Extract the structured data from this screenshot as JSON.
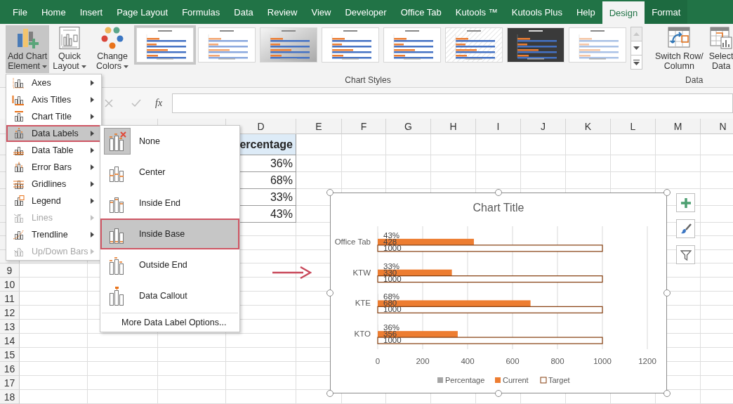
{
  "tabs": [
    {
      "label": "File",
      "selected": false,
      "kind": "main"
    },
    {
      "label": "Home",
      "selected": false,
      "kind": "main"
    },
    {
      "label": "Insert",
      "selected": false,
      "kind": "main"
    },
    {
      "label": "Page Layout",
      "selected": false,
      "kind": "main"
    },
    {
      "label": "Formulas",
      "selected": false,
      "kind": "main"
    },
    {
      "label": "Data",
      "selected": false,
      "kind": "main"
    },
    {
      "label": "Review",
      "selected": false,
      "kind": "main"
    },
    {
      "label": "View",
      "selected": false,
      "kind": "main"
    },
    {
      "label": "Developer",
      "selected": false,
      "kind": "main"
    },
    {
      "label": "Office Tab",
      "selected": false,
      "kind": "main"
    },
    {
      "label": "Kutools ™",
      "selected": false,
      "kind": "main"
    },
    {
      "label": "Kutools Plus",
      "selected": false,
      "kind": "main"
    },
    {
      "label": "Help",
      "selected": false,
      "kind": "main"
    },
    {
      "label": "Design",
      "selected": true,
      "kind": "contextual"
    },
    {
      "label": "Format",
      "selected": false,
      "kind": "contextual"
    }
  ],
  "ribbon": {
    "layout_buttons": [
      {
        "kind": "add-chart",
        "lines": [
          "Add Chart",
          "Element"
        ],
        "dropdown": true,
        "pressed": true
      },
      {
        "kind": "quick-layout",
        "lines": [
          "Quick",
          "Layout"
        ],
        "dropdown": true,
        "pressed": false
      }
    ],
    "styles": {
      "label": "Chart Styles",
      "buttons": [
        {
          "kind": "change-colors",
          "lines": [
            "Change",
            "Colors"
          ],
          "dropdown": true,
          "pressed": false
        }
      ],
      "thumbnails": [
        {
          "kind": "plain",
          "selected": true
        },
        {
          "kind": "dotted",
          "selected": false
        },
        {
          "kind": "gradient",
          "selected": false
        },
        {
          "kind": "plain",
          "selected": false
        },
        {
          "kind": "plain",
          "selected": false
        },
        {
          "kind": "hatched",
          "selected": false
        },
        {
          "kind": "dark",
          "selected": false
        },
        {
          "kind": "faded",
          "selected": false
        }
      ],
      "scroll_up_disabled": true
    },
    "data": {
      "label": "Data",
      "buttons": [
        {
          "kind": "switch-row-column",
          "lines": [
            "Switch Row/",
            "Column"
          ],
          "pressed": false
        },
        {
          "kind": "select-data",
          "lines": [
            "Select",
            "Data"
          ],
          "pressed": false
        }
      ]
    }
  },
  "formula_bar": {
    "function_label": "fx"
  },
  "sheet": {
    "columns": [
      "D",
      "E",
      "F",
      "G",
      "H",
      "I",
      "J",
      "K",
      "L",
      "M",
      "N"
    ],
    "row_numbers": [
      "9",
      "10",
      "11",
      "12",
      "13",
      "14",
      "15",
      "16",
      "17",
      "18"
    ],
    "column_d": [
      {
        "text": "ercentage",
        "kind": "header"
      },
      {
        "text": "36%",
        "kind": "value"
      },
      {
        "text": "68%",
        "kind": "value"
      },
      {
        "text": "33%",
        "kind": "value"
      },
      {
        "text": "43%",
        "kind": "value"
      }
    ]
  },
  "menu": {
    "items": [
      {
        "label": "Axes",
        "kind": "axes",
        "selected": false,
        "disabled": false
      },
      {
        "label": "Axis Titles",
        "kind": "axis-titles",
        "selected": false,
        "disabled": false
      },
      {
        "label": "Chart Title",
        "kind": "chart-title",
        "selected": false,
        "disabled": false
      },
      {
        "label": "Data Labels",
        "kind": "data-labels",
        "selected": true,
        "disabled": false
      },
      {
        "label": "Data Table",
        "kind": "data-table",
        "selected": false,
        "disabled": false
      },
      {
        "label": "Error Bars",
        "kind": "error-bars",
        "selected": false,
        "disabled": false
      },
      {
        "label": "Gridlines",
        "kind": "gridlines",
        "selected": false,
        "disabled": false
      },
      {
        "label": "Legend",
        "kind": "legend",
        "selected": false,
        "disabled": false
      },
      {
        "label": "Lines",
        "kind": "lines",
        "selected": false,
        "disabled": true
      },
      {
        "label": "Trendline",
        "kind": "trendline",
        "selected": false,
        "disabled": false
      },
      {
        "label": "Up/Down Bars",
        "kind": "updown-bars",
        "selected": false,
        "disabled": true
      }
    ]
  },
  "submenu": {
    "items": [
      {
        "label": "None",
        "kind": "none",
        "checked": true,
        "selected": false
      },
      {
        "label": "Center",
        "kind": "center",
        "checked": false,
        "selected": false
      },
      {
        "label": "Inside End",
        "kind": "inside-end",
        "checked": false,
        "selected": false
      },
      {
        "label": "Inside Base",
        "kind": "inside-base",
        "checked": false,
        "selected": true
      },
      {
        "label": "Outside End",
        "kind": "outside-end",
        "checked": false,
        "selected": false
      },
      {
        "label": "Data Callout",
        "kind": "callout",
        "checked": false,
        "selected": false
      }
    ],
    "more_label": "More Data Label Options..."
  },
  "chart": {
    "chart_data": {
      "type": "bar",
      "orientation": "horizontal",
      "title": "Chart Title",
      "categories": [
        "Office Tab",
        "KTW",
        "KTE",
        "KTO"
      ],
      "series": [
        {
          "name": "Percentage",
          "color": "#a5a5a5",
          "values": [
            0.43,
            0.33,
            0.68,
            0.36
          ],
          "value_labels": [
            "43%",
            "33%",
            "68%",
            "36%"
          ]
        },
        {
          "name": "Current",
          "color": "#ed7d31",
          "values": [
            428,
            330,
            680,
            356
          ],
          "value_labels": [
            "428",
            "330",
            "680",
            "356"
          ]
        },
        {
          "name": "Target",
          "color": "#843c0c",
          "values": [
            1000,
            1000,
            1000,
            1000
          ],
          "value_labels": [
            "1000",
            "1000",
            "1000",
            "1000"
          ]
        }
      ],
      "xlim": [
        0,
        1200
      ],
      "xticks": [
        0,
        200,
        400,
        600,
        800,
        1000,
        1200
      ],
      "grid": true,
      "legend": "bottom"
    }
  }
}
